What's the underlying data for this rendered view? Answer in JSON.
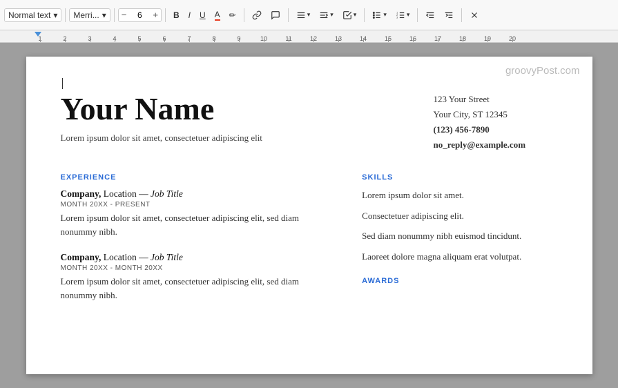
{
  "toolbar": {
    "style_label": "Normal text",
    "style_arrow": "▾",
    "font_label": "Merri...",
    "font_arrow": "▾",
    "font_size": "6",
    "decrease_size": "−",
    "increase_size": "+",
    "bold_label": "B",
    "italic_label": "I",
    "underline_label": "U",
    "font_color_label": "A",
    "highlight_label": "✏",
    "link_label": "🔗",
    "comment_label": "💬",
    "align_label": "≡",
    "line_spacing_label": "↕",
    "checklist_label": "☑",
    "list_label": "≡",
    "num_list_label": "≡",
    "indent_dec_label": "⇤",
    "indent_inc_label": "⇥",
    "clear_label": "✕"
  },
  "ruler": {
    "marks": [
      "1",
      "2",
      "3",
      "4",
      "5",
      "6",
      "7",
      "8",
      "9",
      "10",
      "11",
      "12",
      "13",
      "14",
      "15",
      "16",
      "17",
      "18",
      "19",
      "20"
    ]
  },
  "watermark": "groovyPost.com",
  "resume": {
    "name": "Your Name",
    "tagline": "Lorem ipsum dolor sit amet, consectetuer adipiscing elit",
    "contact": {
      "street": "123 Your Street",
      "city": "Your City, ST 12345",
      "phone": "(123) 456-7890",
      "email": "no_reply@example.com"
    },
    "experience": {
      "section_title": "EXPERIENCE",
      "jobs": [
        {
          "company": "Company,",
          "location_title": " Location — ",
          "job_title": "Job Title",
          "date": "MONTH 20XX - PRESENT",
          "description": "Lorem ipsum dolor sit amet, consectetuer adipiscing elit, sed diam nonummy nibh."
        },
        {
          "company": "Company,",
          "location_title": " Location — ",
          "job_title": "Job Title",
          "date": "MONTH 20XX - MONTH 20XX",
          "description": "Lorem ipsum dolor sit amet, consectetuer adipiscing elit, sed diam nonummy nibh."
        }
      ]
    },
    "skills": {
      "section_title": "SKILLS",
      "items": [
        "Lorem ipsum dolor sit amet.",
        "Consectetuer adipiscing elit.",
        "Sed diam nonummy nibh euismod tincidunt.",
        "Laoreet dolore magna aliquam erat volutpat."
      ]
    },
    "awards": {
      "section_title": "AWARDS"
    }
  }
}
